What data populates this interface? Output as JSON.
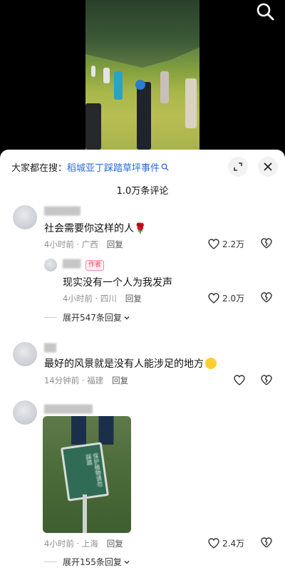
{
  "search_bar": {
    "prefix": "大家都在搜：",
    "term": "稻城亚丁踩踏草坪事件"
  },
  "header": {
    "count_title": "1.0万条评论"
  },
  "comments": [
    {
      "text": "社会需要你这样的人",
      "emoji": "🌹",
      "meta": "4小时前 · 广西",
      "reply": "回复",
      "likes": "2.2万",
      "sub_reply": {
        "badge": "作者",
        "text": "现实没有一个人为我发声",
        "meta": "4小时前 · 四川",
        "reply": "回复",
        "likes": "2.0万"
      },
      "expand": "展开547条回复"
    },
    {
      "text": "最好的风景就是没有人能涉足的地方",
      "meta": "14分钟前 · 福建",
      "reply": "回复"
    },
    {
      "photo_sign_text": "保护植物请勿踩踏",
      "meta": "4小时前 · 上海",
      "reply": "回复",
      "likes": "2.4万",
      "expand": "展开155条回复"
    }
  ],
  "icons": {
    "search": "search-icon",
    "close": "close-icon",
    "collapse": "collapse-icon",
    "like": "heart-icon",
    "dislike": "broken-heart-icon",
    "chevron": "chevron-down-icon"
  }
}
